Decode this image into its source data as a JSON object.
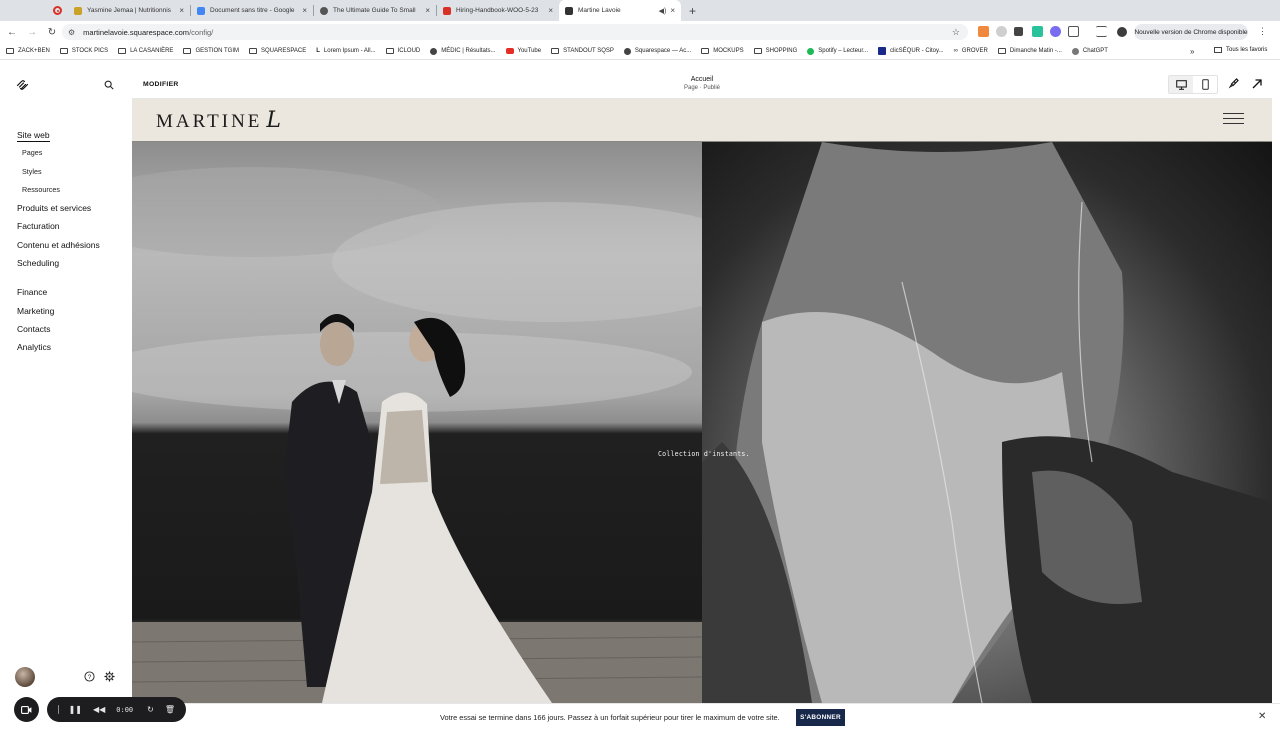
{
  "browser": {
    "tabs": [
      {
        "title": "Yasmine Jemaa | Nutritionnis",
        "color": "#c9a227"
      },
      {
        "title": "Document sans titre - Google",
        "color": "#4285f4"
      },
      {
        "title": "The Ultimate Guide To Small",
        "color": "#555555"
      },
      {
        "title": "Hiring-Handbook-WOO-5-23",
        "color": "#d93025"
      },
      {
        "title": "Martine Lavoie",
        "color": "#333333"
      }
    ],
    "url_domain": "martinelavoie.squarespace.com",
    "url_path": "/config/",
    "update_label": "Nouvelle version de Chrome disponible",
    "bookmarks": [
      {
        "label": "ZACK+BEN",
        "icon": "folder-icon"
      },
      {
        "label": "STOCK PICS",
        "icon": "folder-icon"
      },
      {
        "label": "LA CASANIÈRE",
        "icon": "folder-icon"
      },
      {
        "label": "GESTION TGIM",
        "icon": "folder-icon"
      },
      {
        "label": "SQUARESPACE",
        "icon": "folder-icon"
      },
      {
        "label": "Lorem Ipsum - All...",
        "icon": "text-icon"
      },
      {
        "label": "ICLOUD",
        "icon": "folder-icon"
      },
      {
        "label": "MÉDIC | Résultats...",
        "icon": "globe-icon"
      },
      {
        "label": "YouTube",
        "icon": "youtube-icon"
      },
      {
        "label": "STANDOUT SQSP",
        "icon": "folder-icon"
      },
      {
        "label": "Squarespace — Ac...",
        "icon": "globe-icon"
      },
      {
        "label": "MOCKUPS",
        "icon": "folder-icon"
      },
      {
        "label": "SHOPPING",
        "icon": "folder-icon"
      },
      {
        "label": "Spotify – Lecteur...",
        "icon": "spotify-icon"
      },
      {
        "label": "clicSÉQUR - Citoy...",
        "icon": "quebec-icon"
      },
      {
        "label": "GROVER",
        "icon": "link-icon"
      },
      {
        "label": "Dimanche Matin -...",
        "icon": "folder-icon"
      },
      {
        "label": "ChatGPT",
        "icon": "openai-icon"
      }
    ],
    "all_bookmarks": "Tous les favoris"
  },
  "sidebar": {
    "items": [
      {
        "label": "Site web",
        "level": "main",
        "active": true
      },
      {
        "label": "Pages",
        "level": "sub"
      },
      {
        "label": "Styles",
        "level": "sub"
      },
      {
        "label": "Ressources",
        "level": "sub"
      },
      {
        "label": "Produits et services",
        "level": "main"
      },
      {
        "label": "Facturation",
        "level": "main"
      },
      {
        "label": "Contenu et adhésions",
        "level": "main"
      },
      {
        "label": "Scheduling",
        "level": "main"
      },
      {
        "label": "Finance",
        "level": "main",
        "gap_before": true
      },
      {
        "label": "Marketing",
        "level": "main"
      },
      {
        "label": "Contacts",
        "level": "main"
      },
      {
        "label": "Analytics",
        "level": "main"
      }
    ]
  },
  "editor": {
    "modify_label": "MODIFIER",
    "page_title": "Accueil",
    "page_status": "Page · Publié"
  },
  "site": {
    "brand": "MARTINE",
    "brand_script": "L",
    "header_bg": "#ebe7de",
    "caption": "Collection d'instants."
  },
  "trial": {
    "message": "Votre essai se termine dans 166 jours. Passez à un forfait supérieur pour tirer le maximum de votre site.",
    "button": "S'ABONNER",
    "button_color": "#17284a"
  },
  "recorder": {
    "time": "0:00"
  }
}
